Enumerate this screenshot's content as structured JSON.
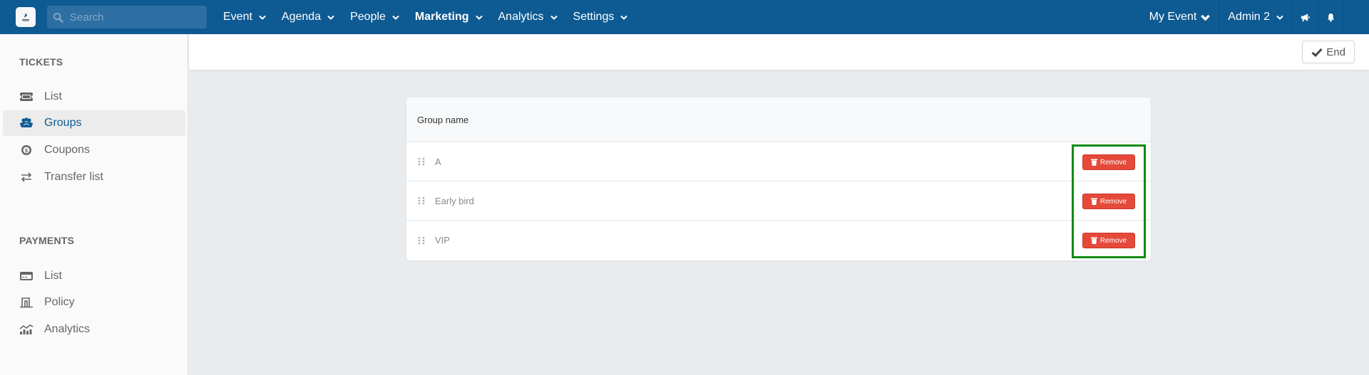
{
  "topbar": {
    "search_placeholder": "Search",
    "nav": [
      {
        "label": "Event",
        "active": false
      },
      {
        "label": "Agenda",
        "active": false
      },
      {
        "label": "People",
        "active": false
      },
      {
        "label": "Marketing",
        "active": true
      },
      {
        "label": "Analytics",
        "active": false
      },
      {
        "label": "Settings",
        "active": false
      }
    ],
    "event_selector": "My Event",
    "user_menu": "Admin 2",
    "icons": [
      "megaphone-icon",
      "bell-icon"
    ]
  },
  "sidebar": {
    "tickets_title": "TICKETS",
    "tickets_items": [
      {
        "label": "List",
        "icon": "ticket-icon"
      },
      {
        "label": "Groups",
        "icon": "group-icon",
        "active": true
      },
      {
        "label": "Coupons",
        "icon": "coupon-icon"
      },
      {
        "label": "Transfer list",
        "icon": "transfer-icon"
      }
    ],
    "payments_title": "PAYMENTS",
    "payments_items": [
      {
        "label": "List",
        "icon": "credit-card-icon"
      },
      {
        "label": "Policy",
        "icon": "policy-icon"
      },
      {
        "label": "Analytics",
        "icon": "analytics-icon"
      }
    ]
  },
  "header": {
    "end_label": "End"
  },
  "table": {
    "column_header": "Group name",
    "rows": [
      {
        "name": "A",
        "action": "Remove"
      },
      {
        "name": "Early bird",
        "action": "Remove"
      },
      {
        "name": "VIP",
        "action": "Remove"
      }
    ]
  },
  "colors": {
    "topbar": "#0e5a93",
    "accent": "#0e5a93",
    "danger": "#e5493a",
    "highlight": "#138a13"
  }
}
